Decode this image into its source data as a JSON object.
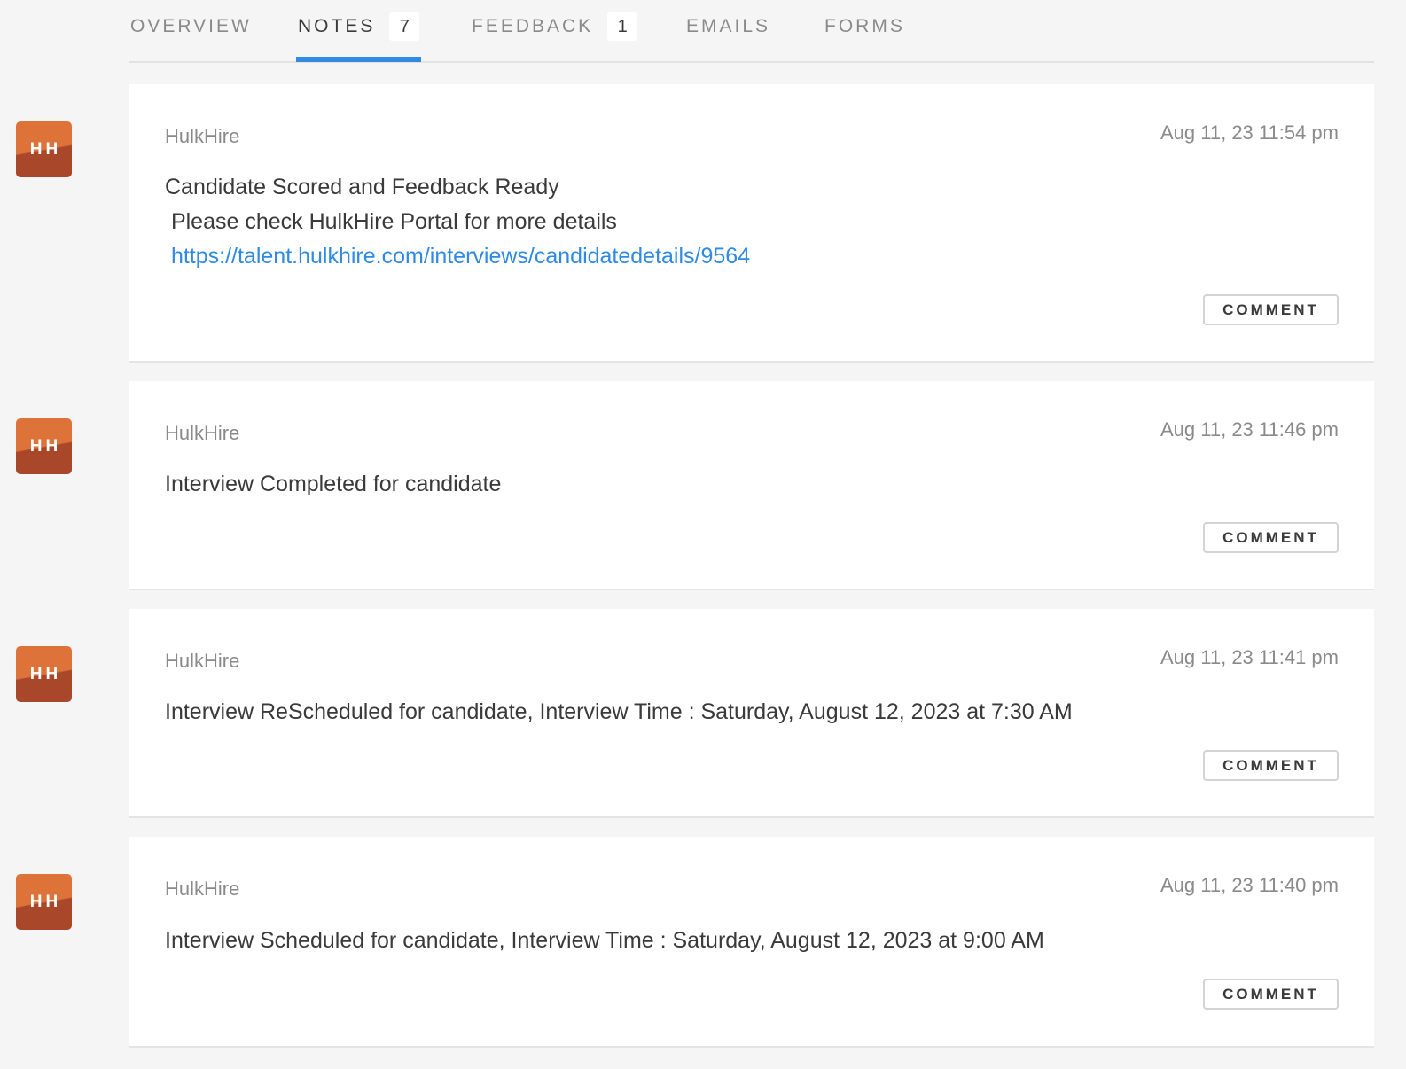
{
  "tabs": [
    {
      "label": "OVERVIEW",
      "count": null
    },
    {
      "label": "NOTES",
      "count": "7"
    },
    {
      "label": "FEEDBACK",
      "count": "1"
    },
    {
      "label": "EMAILS",
      "count": null
    },
    {
      "label": "FORMS",
      "count": null
    }
  ],
  "active_tab": "NOTES",
  "colors": {
    "accent": "#2f8ae3",
    "avatar_top": "#de7339",
    "avatar_bottom": "#a8472a"
  },
  "notes": [
    {
      "avatar": "HH",
      "author": "HulkHire",
      "timestamp": "Aug 11, 23 11:54 pm",
      "line1": "Candidate Scored and Feedback Ready",
      "line2": " Please check HulkHire Portal for more details",
      "link": "https://talent.hulkhire.com/interviews/candidatedetails/9564",
      "comment_label": "COMMENT"
    },
    {
      "avatar": "HH",
      "author": "HulkHire",
      "timestamp": "Aug 11, 23 11:46 pm",
      "line1": "Interview Completed for candidate",
      "comment_label": "COMMENT"
    },
    {
      "avatar": "HH",
      "author": "HulkHire",
      "timestamp": "Aug 11, 23 11:41 pm",
      "line1": "Interview ReScheduled for candidate, Interview Time : Saturday, August 12, 2023 at 7:30 AM",
      "comment_label": "COMMENT"
    },
    {
      "avatar": "HH",
      "author": "HulkHire",
      "timestamp": "Aug 11, 23 11:40 pm",
      "line1": "Interview Scheduled for candidate, Interview Time : Saturday, August 12, 2023 at 9:00 AM",
      "comment_label": "COMMENT"
    }
  ]
}
